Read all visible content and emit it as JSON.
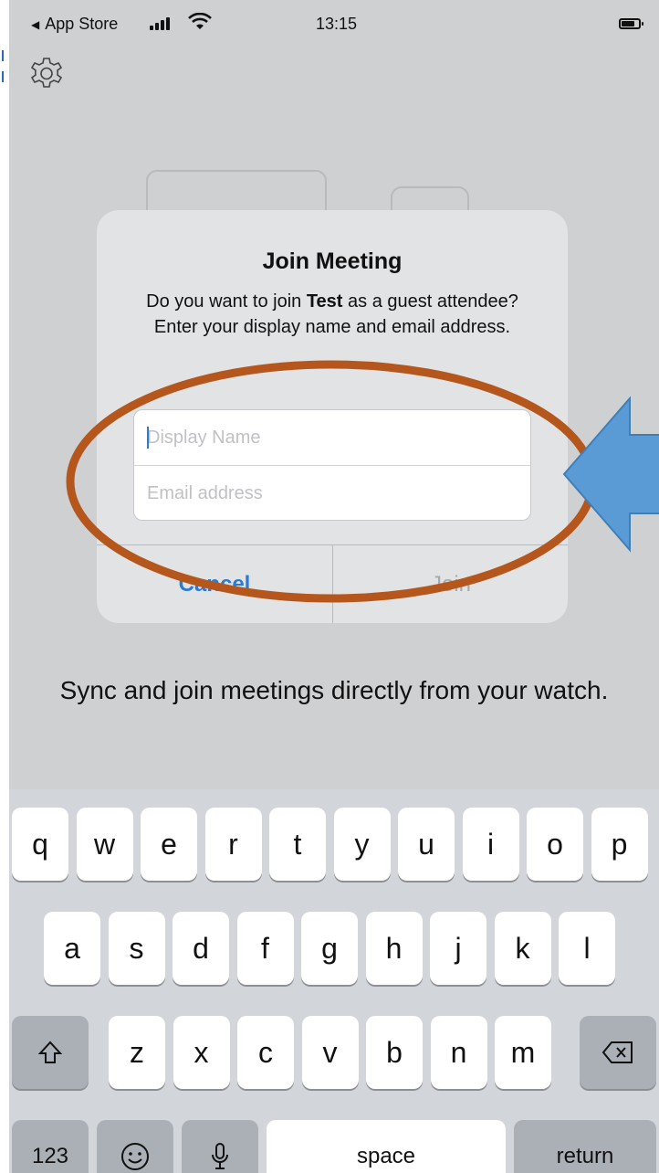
{
  "status_bar": {
    "back_app": "App Store",
    "time": "13:15"
  },
  "alert": {
    "title": "Join Meeting",
    "message_prefix": "Do you want to join ",
    "meeting_name": "Test",
    "message_suffix": "  as a guest attendee? Enter your display name and email address.",
    "display_name_placeholder": "Display Name",
    "email_placeholder": "Email address",
    "cancel_label": "Cancel",
    "join_label": "Join"
  },
  "description": "Sync and join meetings directly from your watch.",
  "keyboard": {
    "row1": [
      "q",
      "w",
      "e",
      "r",
      "t",
      "y",
      "u",
      "i",
      "o",
      "p"
    ],
    "row2": [
      "a",
      "s",
      "d",
      "f",
      "g",
      "h",
      "j",
      "k",
      "l"
    ],
    "row3": [
      "z",
      "x",
      "c",
      "v",
      "b",
      "n",
      "m"
    ],
    "numbers_label": "123",
    "space_label": "space",
    "return_label": "return"
  },
  "colors": {
    "accent": "#2a7bd4",
    "annotation_ellipse": "#b5571d",
    "annotation_arrow": "#5b9bd5"
  }
}
